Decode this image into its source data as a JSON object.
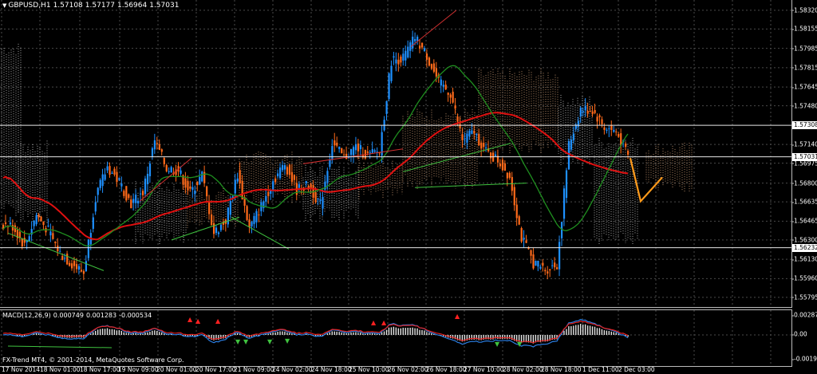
{
  "header": {
    "symbol": "GBPUSD,H1",
    "open": "1.57108",
    "high": "1.57177",
    "low": "1.56964",
    "close": "1.57031"
  },
  "macd": {
    "label": "MACD(12,26,9)",
    "main": "0.000749",
    "signal": "0.001283",
    "hist": "-0.000534",
    "axis_top": "0.002871",
    "axis_zero": "0.00",
    "axis_bottom": "-0.001979"
  },
  "copyright": "FX-Trend MT4, © 2001-2014, MetaQuotes Software Corp.",
  "price_axis": {
    "ticks": [
      "1.58320",
      "1.58155",
      "1.57985",
      "1.57815",
      "1.57645",
      "1.57480",
      "1.57140",
      "1.56975",
      "1.56800",
      "1.56635",
      "1.56465",
      "1.56300",
      "1.56130",
      "1.55960",
      "1.55795"
    ],
    "tag_line_1": "1.57308",
    "tag_current": "1.57031",
    "tag_line_2": "1.56232"
  },
  "time_axis": [
    "17 Nov 2014",
    "18 Nov 01:00",
    "18 Nov 17:00",
    "19 Nov 09:00",
    "20 Nov 01:00",
    "20 Nov 17:00",
    "21 Nov 09:00",
    "24 Nov 02:00",
    "24 Nov 18:00",
    "25 Nov 10:00",
    "26 Nov 02:00",
    "26 Nov 18:00",
    "27 Nov 10:00",
    "28 Nov 02:00",
    "28 Nov 18:00",
    "1 Dec 11:00",
    "2 Dec 03:00"
  ],
  "colors": {
    "background": "#000000",
    "bull_candle": "#1e90ff",
    "bear_candle": "#ff6a1a",
    "ma_red": "#e01010",
    "ma_green": "#1f8f1f",
    "cloud_up": "#c8c8c8",
    "cloud_down": "#d4a37a",
    "grid": "#4a4a4a",
    "forecast": "#ff9a1a"
  },
  "chart_data": {
    "type": "candlestick",
    "title": "GBPUSD,H1",
    "ylim": [
      1.5571,
      1.5841
    ],
    "x_labels": [
      "17 Nov 2014",
      "18 Nov 01:00",
      "18 Nov 17:00",
      "19 Nov 09:00",
      "20 Nov 01:00",
      "20 Nov 17:00",
      "21 Nov 09:00",
      "24 Nov 02:00",
      "24 Nov 18:00",
      "25 Nov 10:00",
      "26 Nov 02:00",
      "26 Nov 18:00",
      "27 Nov 10:00",
      "28 Nov 02:00",
      "28 Nov 18:00",
      "1 Dec 11:00",
      "2 Dec 03:00"
    ],
    "close_path": [
      1.5644,
      1.5642,
      1.5625,
      1.5652,
      1.5638,
      1.5618,
      1.5609,
      1.5601,
      1.5668,
      1.5694,
      1.5681,
      1.5662,
      1.5672,
      1.5717,
      1.5693,
      1.5691,
      1.5671,
      1.5687,
      1.5636,
      1.5647,
      1.5688,
      1.564,
      1.566,
      1.5682,
      1.5697,
      1.5674,
      1.5678,
      1.5661,
      1.5715,
      1.5702,
      1.5712,
      1.5704,
      1.5708,
      1.5788,
      1.579,
      1.5808,
      1.5792,
      1.5768,
      1.5759,
      1.5718,
      1.5725,
      1.5707,
      1.57,
      1.5686,
      1.5632,
      1.561,
      1.5604,
      1.5608,
      1.5713,
      1.5745,
      1.5744,
      1.5729,
      1.5725,
      1.5704
    ],
    "horizontal_levels": [
      1.57308,
      1.57031,
      1.56232
    ],
    "current_price": 1.57031
  }
}
